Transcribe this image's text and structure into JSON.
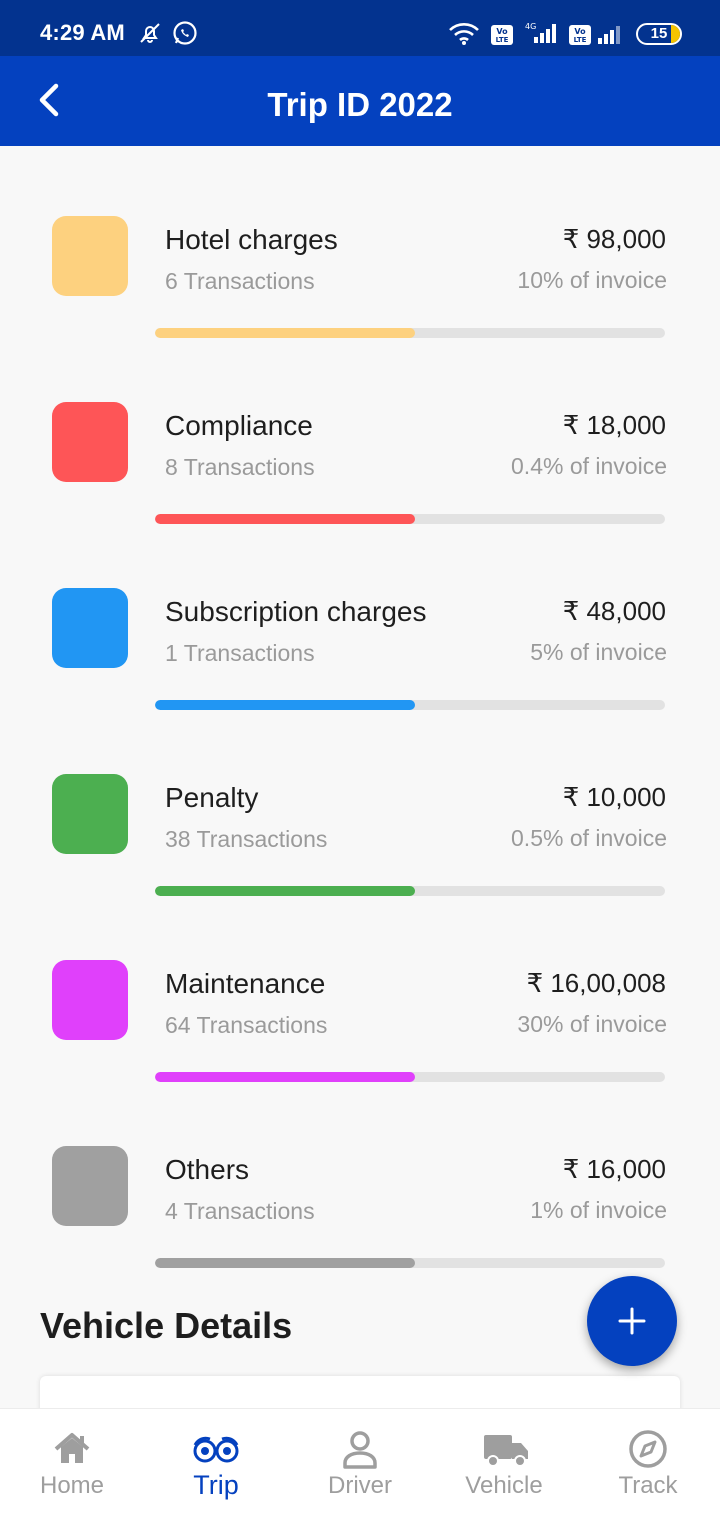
{
  "status_bar": {
    "time": "4:29 AM",
    "battery_level": "15",
    "icons": [
      "mute-icon",
      "whatsapp-icon",
      "wifi-icon",
      "volte-icon",
      "4g-signal-icon",
      "volte-icon",
      "signal-icon",
      "battery-icon"
    ]
  },
  "header": {
    "title": "Trip ID 2022",
    "back_icon": "back-arrow-icon"
  },
  "categories": [
    {
      "name": "Hotel charges",
      "transactions": "6 Transactions",
      "amount": "₹ 98,000",
      "percent": "10% of invoice",
      "color": "#fdd17f",
      "progress": 0.51
    },
    {
      "name": "Compliance",
      "transactions": "8 Transactions",
      "amount": "₹ 18,000",
      "percent": "0.4% of invoice",
      "color": "#fe5557",
      "progress": 0.51
    },
    {
      "name": "Subscription charges",
      "transactions": "1 Transactions",
      "amount": "₹ 48,000",
      "percent": "5% of invoice",
      "color": "#2196f3",
      "progress": 0.51
    },
    {
      "name": "Penalty",
      "transactions": "38 Transactions",
      "amount": "₹ 10,000",
      "percent": "0.5% of invoice",
      "color": "#4caf50",
      "progress": 0.51
    },
    {
      "name": "Maintenance",
      "transactions": "64 Transactions",
      "amount": "₹ 16,00,008",
      "percent": "30% of invoice",
      "color": "#e040fb",
      "progress": 0.51
    },
    {
      "name": "Others",
      "transactions": "4 Transactions",
      "amount": "₹ 16,000",
      "percent": "1% of invoice",
      "color": "#a0a0a0",
      "progress": 0.51
    }
  ],
  "vehicle_details": {
    "title": "Vehicle Details"
  },
  "fab": {
    "icon": "plus-icon",
    "color": "#0441bf"
  },
  "bottom_nav": {
    "active": "Trip",
    "items": [
      {
        "label": "Home",
        "icon": "home-icon"
      },
      {
        "label": "Trip",
        "icon": "binoculars-icon"
      },
      {
        "label": "Driver",
        "icon": "person-icon"
      },
      {
        "label": "Vehicle",
        "icon": "truck-icon"
      },
      {
        "label": "Track",
        "icon": "compass-icon"
      }
    ]
  },
  "colors": {
    "status_bar": "#03338f",
    "app_bar": "#0441bf",
    "background": "#f8f8f8",
    "primary_text": "#1e1e1e",
    "secondary_text": "#9a9a9a",
    "inactive_nav": "#9e9e9e"
  }
}
